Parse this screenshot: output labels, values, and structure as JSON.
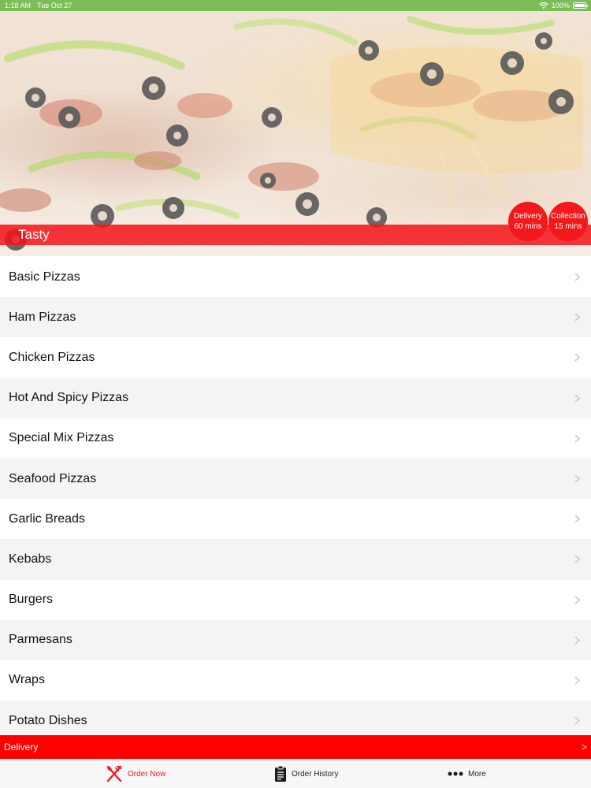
{
  "status_bar": {
    "time": "1:18 AM",
    "date": "Tue Oct 27",
    "battery": "100%"
  },
  "hero": {
    "restaurant_name": "Tasty",
    "delivery": {
      "label": "Delivery",
      "time": "60 mins"
    },
    "collection": {
      "label": "Collection",
      "time": "15 mins"
    }
  },
  "menu": {
    "items": [
      {
        "label": "Basic Pizzas"
      },
      {
        "label": "Ham Pizzas"
      },
      {
        "label": "Chicken Pizzas"
      },
      {
        "label": "Hot And Spicy Pizzas"
      },
      {
        "label": "Special Mix Pizzas"
      },
      {
        "label": "Seafood Pizzas"
      },
      {
        "label": "Garlic Breads"
      },
      {
        "label": "Kebabs"
      },
      {
        "label": "Burgers"
      },
      {
        "label": "Parmesans"
      },
      {
        "label": "Wraps"
      },
      {
        "label": "Potato Dishes"
      }
    ]
  },
  "delivery_bar": {
    "label": "Delivery",
    "arrow": ">"
  },
  "tab_bar": {
    "order_now": "Order Now",
    "order_history": "Order History",
    "more": "More"
  },
  "colors": {
    "brand_red": "#ff0000",
    "badge_red": "#f2181c",
    "status_green": "#7cbd57",
    "active_tab": "#ee1c24"
  }
}
